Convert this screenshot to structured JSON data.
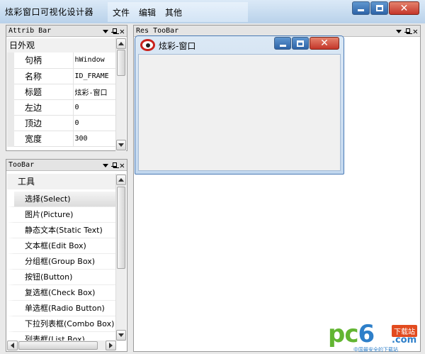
{
  "app": {
    "title": "炫彩窗口可视化设计器"
  },
  "menu": [
    {
      "label": "文件"
    },
    {
      "label": "编辑"
    },
    {
      "label": "其他"
    }
  ],
  "panels": {
    "attrib": {
      "title": "Attrib Bar",
      "category": "日外观",
      "properties": [
        {
          "key": "句柄",
          "value": "hWindow"
        },
        {
          "key": "名称",
          "value": "ID_FRAME"
        },
        {
          "key": "标题",
          "value": "炫彩-窗口"
        },
        {
          "key": "左边",
          "value": "0"
        },
        {
          "key": "顶边",
          "value": "0"
        },
        {
          "key": "宽度",
          "value": "300"
        }
      ]
    },
    "toolbar": {
      "title": "TooBar",
      "header": "工具",
      "items": [
        "选择(Select)",
        "图片(Picture)",
        "静态文本(Static Text)",
        "文本框(Edit Box)",
        "分组框(Group Box)",
        "按钮(Button)",
        "复选框(Check Box)",
        "单选框(Radio Button)",
        "下拉列表框(Combo Box)",
        "列表框(List Box)"
      ],
      "selected_index": 0
    },
    "res": {
      "title": "Res TooBar"
    }
  },
  "design_window": {
    "title": "炫彩-窗口"
  },
  "watermark": {
    "logo_pc": "pc",
    "logo_six": "6",
    "badge": "下载站",
    "com": ".com",
    "slogan": "中国最安全的下载站"
  },
  "colors": {
    "titlebar": "#c6dbef",
    "close_button": "#c4362a",
    "window_button": "#2d63a7",
    "selected_row": "#dcdcdc"
  }
}
